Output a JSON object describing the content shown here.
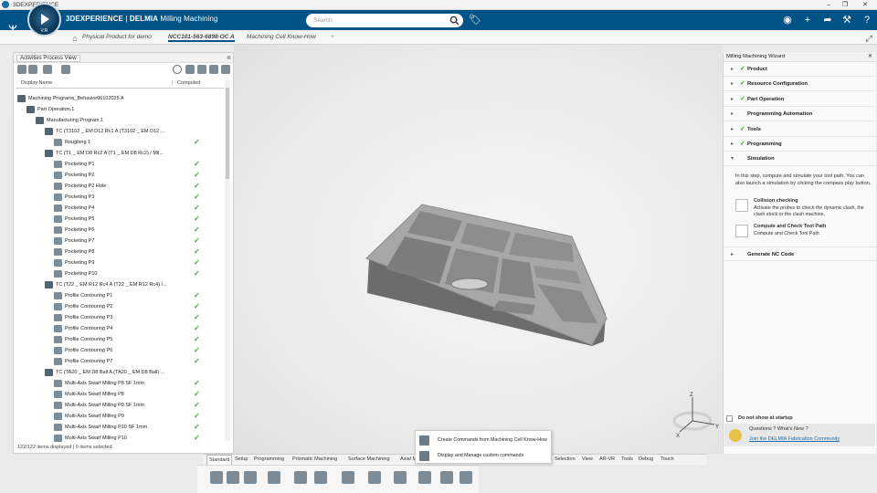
{
  "window": {
    "title": "3DEXPERIENCE",
    "minimize": "–",
    "restore": "❐",
    "close": "✕"
  },
  "appbar": {
    "brand_bold": "3DEXPERIENCE",
    "brand_sep": " | ",
    "brand_app": "DELMIA",
    "brand_module": "Milling Machining",
    "compass_version": "V.R",
    "search_placeholder": "Search"
  },
  "tabs": [
    "Physical Product for demo",
    "NCC101-563-6898-OC A",
    "Machining Cell Know-How"
  ],
  "panel": {
    "title": "Activities Process View",
    "columns": {
      "display_name": "Display Name",
      "computed": "Computed"
    },
    "tree": [
      {
        "label": "Machining Programs_Behavior06102025 A",
        "level": 0,
        "check": false
      },
      {
        "label": "Part Operation.1",
        "level": 1,
        "check": false
      },
      {
        "label": "Manufacturing Program.1",
        "level": 2,
        "check": false
      },
      {
        "label": "TC (T3102 _ EM D12 Rc1 A (T3102 _ EM D12 ...",
        "level": 3,
        "check": false
      },
      {
        "label": "Roughing 1",
        "level": 4,
        "check": true
      },
      {
        "label": "TC (T1 _ EM D8 Rc2 A (T1 _ EM D8 Rc2) / Mil...",
        "level": 3,
        "check": false
      },
      {
        "label": "Pocketing P1",
        "level": 4,
        "check": true
      },
      {
        "label": "Pocketing P2",
        "level": 4,
        "check": true
      },
      {
        "label": "Pocketing P2 Hole",
        "level": 4,
        "check": true
      },
      {
        "label": "Pocketing P3",
        "level": 4,
        "check": true
      },
      {
        "label": "Pocketing P4",
        "level": 4,
        "check": true
      },
      {
        "label": "Pocketing P5",
        "level": 4,
        "check": true
      },
      {
        "label": "Pocketing P6",
        "level": 4,
        "check": true
      },
      {
        "label": "Pocketing P7",
        "level": 4,
        "check": true
      },
      {
        "label": "Pocketing P8",
        "level": 4,
        "check": true
      },
      {
        "label": "Pocketing P9",
        "level": 4,
        "check": true
      },
      {
        "label": "Pocketing P10",
        "level": 4,
        "check": true
      },
      {
        "label": "TC (T22 _ EM R12 Rc4 A (T22 _ EM R12 Rc4) /...",
        "level": 3,
        "check": false
      },
      {
        "label": "Profile Contouring P1",
        "level": 4,
        "check": true
      },
      {
        "label": "Profile Contouring P2",
        "level": 4,
        "check": true
      },
      {
        "label": "Profile Contouring P3",
        "level": 4,
        "check": true
      },
      {
        "label": "Profile Contouring P4",
        "level": 4,
        "check": true
      },
      {
        "label": "Profile Contouring P5",
        "level": 4,
        "check": true
      },
      {
        "label": "Profile Contouring P6",
        "level": 4,
        "check": true
      },
      {
        "label": "Profile Contouring P7",
        "level": 4,
        "check": true
      },
      {
        "label": "TC (TA20 _ EM D8 Ball A (TA20 _ EM D8 Ball) ...",
        "level": 3,
        "check": false
      },
      {
        "label": "Multi-Axis Swarf Milling P8 SF 1mm",
        "level": 4,
        "check": true
      },
      {
        "label": "Multi-Axis Swarf Milling P8",
        "level": 4,
        "check": true
      },
      {
        "label": "Multi-Axis Swarf Milling P9 SF 1mm",
        "level": 4,
        "check": true
      },
      {
        "label": "Multi-Axis Swarf Milling P9",
        "level": 4,
        "check": true
      },
      {
        "label": "Multi-Axis Swarf Milling P10 SF 1mm",
        "level": 4,
        "check": true
      },
      {
        "label": "Multi-Axis Swarf Milling P10",
        "level": 4,
        "check": true
      }
    ],
    "status": "122/122 items displayed | 0 items selected"
  },
  "wizard": {
    "title": "Milling Machining Wizard",
    "steps": [
      {
        "label": "Product",
        "done": true
      },
      {
        "label": "Resource Configuration",
        "done": true
      },
      {
        "label": "Part Operation",
        "done": true
      },
      {
        "label": "Programming Automation",
        "done": false
      },
      {
        "label": "Tools",
        "done": true
      },
      {
        "label": "Programming",
        "done": true
      },
      {
        "label": "Simulation",
        "done": false
      }
    ],
    "sim_text": "In this step, compute and simulate your tool path. You can also launch a simulation by clicking the compass play button.",
    "collision_title": "Collision checking",
    "collision_desc": "Activate the probes to check the dynamic clash, the clash stock or the clash machine.",
    "compute_title": "Compute and Check Tool Path",
    "compute_desc": "Compute and Check Tool Path",
    "last_step": "Generate NC Code",
    "no_show": "Do not show at startup",
    "questions": "Questions ? What's New ?",
    "community": "Join the DELMIA Fabrication Community"
  },
  "bottom_tabs": [
    "Standard",
    "Setup",
    "Programming",
    "Prismatic Machining",
    "Surface Machining",
    "Axial M",
    "Selection",
    "View",
    "AR-VR",
    "Tools",
    "Debug",
    "Touch"
  ],
  "popup": {
    "item1": "Create Commands from Machining Cell Know-How",
    "item2": "Display and Manage custom commands"
  },
  "triad": {
    "z": "Z",
    "x": "X",
    "y": "Y"
  },
  "colors": {
    "appbar": "#005386",
    "check": "#3da12a"
  }
}
